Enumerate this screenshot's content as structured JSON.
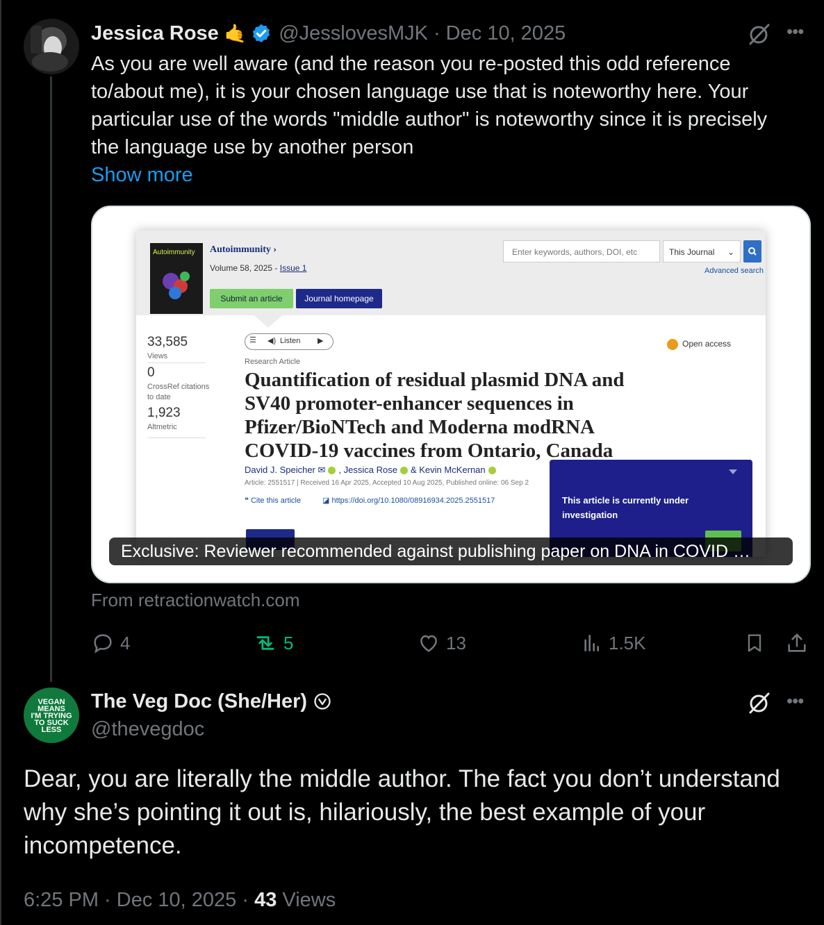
{
  "tweet1": {
    "name": "Jessica Rose",
    "emoji": "🤙",
    "handle": "@JesslovesMJK",
    "date": "· Dec 10, 2025",
    "text": "As you are well aware (and the reason you re-posted this odd reference to/about me), it is your chosen language use that is noteworthy here. Your particular use of the words \"middle author\" is noteworthy since it is precisely the language use by another person",
    "show_more": "Show more",
    "card": {
      "caption": "Exclusive: Reviewer recommended against publishing paper on DNA in COVID …",
      "source": "From retractionwatch.com",
      "journal": {
        "cover_title": "Autoimmunity",
        "name": "Autoimmunity ›",
        "volume": "Volume 58, 2025 - ",
        "issue": "Issue 1",
        "submit": "Submit an article",
        "homepage": "Journal homepage",
        "search_placeholder": "Enter keywords, authors, DOI, etc",
        "scope": "This Journal",
        "advanced": "Advanced search"
      },
      "metrics": [
        {
          "value": "33,585",
          "label": "Views"
        },
        {
          "value": "0",
          "label": "CrossRef citations to date"
        },
        {
          "value": "1,923",
          "label": "Altmetric"
        }
      ],
      "listen": "Listen",
      "open_access": "Open access",
      "article_type": "Research Article",
      "article_title": "Quantification of residual plasmid DNA and SV40 promoter-enhancer sequences in Pfizer/BioNTech and Moderna modRNA COVID-19 vaccines from Ontario, Canada",
      "author1": "David J. Speicher",
      "author2": ", Jessica Rose",
      "author3": "& Kevin McKernan",
      "article_meta": "Article: 2551517 | Received 16 Apr 2025, Accepted 10 Aug 2025, Published online: 06 Sep 2",
      "cite": "Cite this article",
      "doi": "https://doi.org/10.1080/08916934.2025.2551517",
      "investigation": "This article is currently under investigation"
    },
    "actions": {
      "replies": "4",
      "reposts": "5",
      "likes": "13",
      "views": "1.5K"
    },
    "colors": {
      "repost": "#00ba7c",
      "link": "#1d9bf0",
      "verified": "#1d9bf0"
    }
  },
  "tweet2": {
    "name": "The Veg Doc (She/Her)",
    "handle": "@thevegdoc",
    "avatar_text": [
      "VEGAN",
      "MEANS",
      "I'M TRYING",
      "TO SUCK",
      "LESS"
    ],
    "text": "Dear, you are literally the middle author. The fact you don’t understand why she’s pointing it out is, hilariously, the best example of your incompetence.",
    "time": "6:25 PM · Dec 10, 2025 · ",
    "views_count": "43",
    "views_label": " Views"
  },
  "icons": [
    "grok-icon",
    "more-icon",
    "reply-icon",
    "repost-icon",
    "like-icon",
    "views-icon",
    "bookmark-icon",
    "share-icon",
    "verified-icon",
    "verified-outline-icon"
  ]
}
